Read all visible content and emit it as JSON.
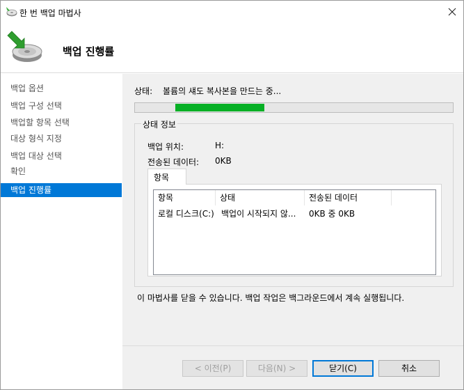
{
  "window": {
    "title": "한 번 백업 마법사"
  },
  "header": {
    "title": "백업 진행률"
  },
  "nav": {
    "items": [
      {
        "label": "백업 옵션"
      },
      {
        "label": "백업 구성 선택"
      },
      {
        "label": "백업할 항목 선택"
      },
      {
        "label": "대상 형식 지정"
      },
      {
        "label": "백업 대상 선택"
      },
      {
        "label": "확인"
      },
      {
        "label": "백업 진행률",
        "active": true
      }
    ]
  },
  "status": {
    "label": "상태:",
    "text": "볼륨의 섀도 복사본을 만드는 중...",
    "progress_fraction": 0.28,
    "progress_color": "#06b025"
  },
  "details": {
    "legend": "상태 정보",
    "location_label": "백업 위치:",
    "location_value": "H:",
    "transferred_label": "전송된 데이터:",
    "transferred_value": "0KB",
    "tab_label": "항목",
    "columns": [
      "항목",
      "상태",
      "전송된 데이터"
    ],
    "rows": [
      {
        "item": "로컬 디스크(C:)",
        "status": "백업이 시작되지 않...",
        "transferred": "0KB 중 0KB"
      }
    ]
  },
  "note": "이 마법사를 닫을 수 있습니다. 백업 작업은 백그라운드에서 계속 실행됩니다.",
  "buttons": {
    "prev": "< 이전(P)",
    "next": "다음(N) >",
    "close": "닫기(C)",
    "cancel": "취소"
  },
  "icons": {
    "title": "backup-app-icon",
    "header": "backup-disk-icon",
    "close": "close-icon"
  },
  "colors": {
    "accent": "#0078d7"
  }
}
